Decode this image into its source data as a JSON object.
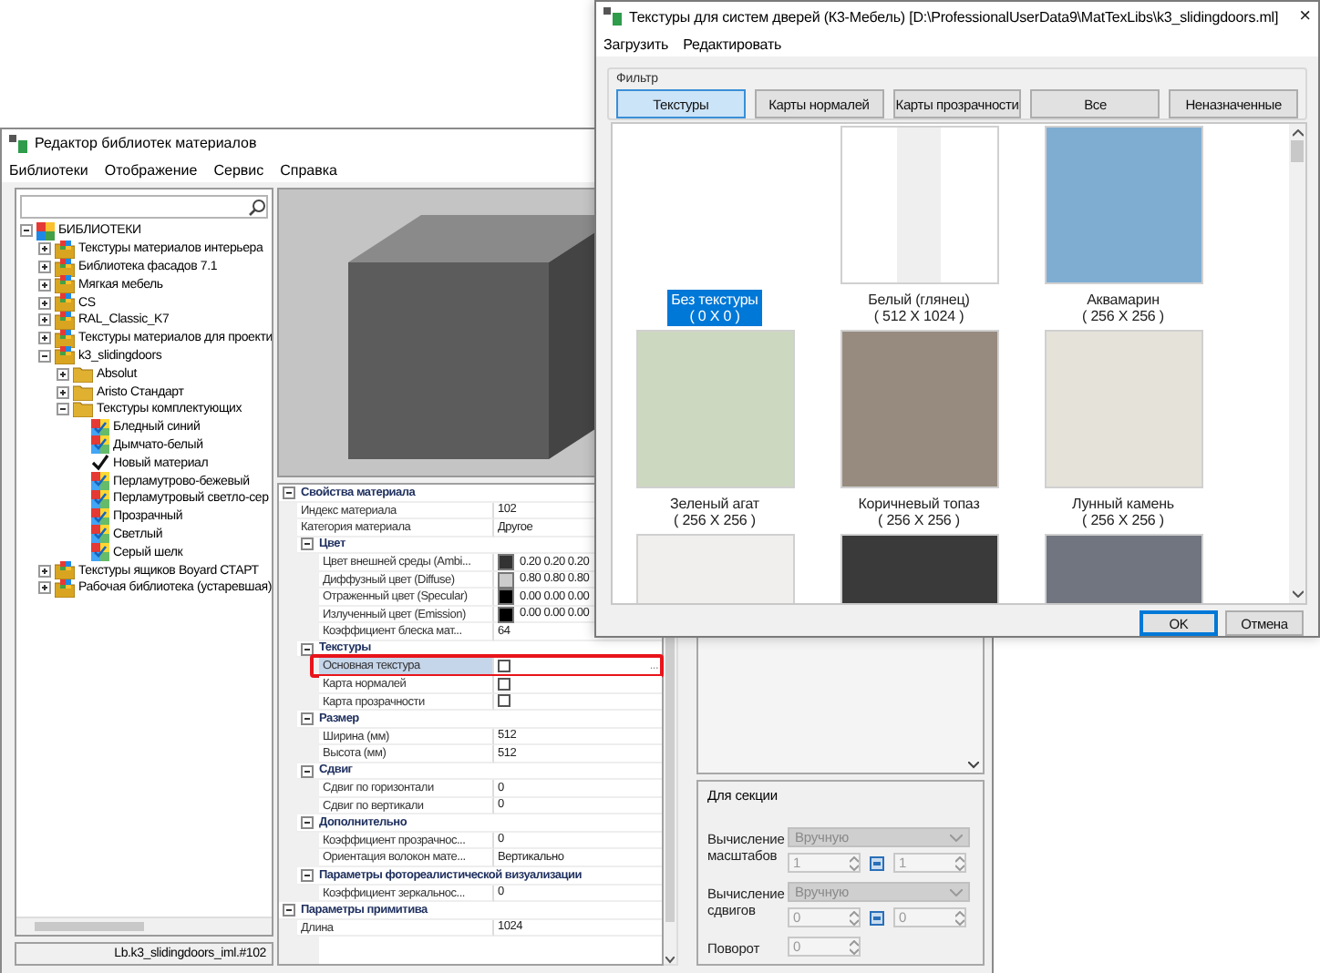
{
  "main_window": {
    "title": "Редактор библиотек материалов",
    "menu": [
      "Библиотеки",
      "Отображение",
      "Сервис",
      "Справка"
    ],
    "tree": [
      {
        "label": "БИБЛИОТЕКИ",
        "kind": "root",
        "expanded": true,
        "children": [
          {
            "label": "Текстуры материалов интерьера",
            "kind": "library",
            "expanded": false
          },
          {
            "label": "Библиотека фасадов 7.1",
            "kind": "library",
            "expanded": false
          },
          {
            "label": "Мягкая мебель",
            "kind": "library",
            "expanded": false
          },
          {
            "label": "CS",
            "kind": "library",
            "expanded": false
          },
          {
            "label": "RAL_Classic_K7",
            "kind": "library",
            "expanded": false
          },
          {
            "label": "Текстуры материалов для проекти",
            "kind": "library",
            "expanded": false
          },
          {
            "label": "k3_slidingdoors",
            "kind": "library",
            "expanded": true,
            "children": [
              {
                "label": "Absolut",
                "kind": "folder",
                "expanded": false
              },
              {
                "label": "Aristo Стандарт",
                "kind": "folder",
                "expanded": false
              },
              {
                "label": "Текстуры комплектующих",
                "kind": "folder",
                "expanded": true,
                "children": [
                  {
                    "label": "Бледный синий",
                    "kind": "material"
                  },
                  {
                    "label": "Дымчато-белый",
                    "kind": "material"
                  },
                  {
                    "label": "Новый материал",
                    "kind": "draft"
                  },
                  {
                    "label": "Перламутрово-бежевый",
                    "kind": "material"
                  },
                  {
                    "label": "Перламутровый светло-сер",
                    "kind": "material"
                  },
                  {
                    "label": "Прозрачный",
                    "kind": "material"
                  },
                  {
                    "label": "Светлый",
                    "kind": "material"
                  },
                  {
                    "label": "Серый шелк",
                    "kind": "material"
                  }
                ]
              }
            ]
          },
          {
            "label": "Текстуры ящиков Boyard СТАРТ",
            "kind": "library",
            "expanded": false
          },
          {
            "label": "Рабочая библиотека (устаревшая)",
            "kind": "library",
            "expanded": false
          }
        ]
      }
    ],
    "status": "Lb.k3_slidingdoors_iml.#102",
    "properties": [
      {
        "label": "Свойства материала",
        "expanded": true,
        "rows": [
          {
            "label": "Индекс материала",
            "value": "102",
            "kind": "text"
          },
          {
            "label": "Категория материала",
            "value": "Другое",
            "kind": "text"
          }
        ],
        "groups": [
          {
            "label": "Цвет",
            "expanded": true,
            "rows": [
              {
                "label": "Цвет внешней среды (Ambi...",
                "value": "0.20 0.20 0.20",
                "kind": "color",
                "color": "#333333"
              },
              {
                "label": "Диффузный цвет (Diffuse)",
                "value": "0.80 0.80 0.80",
                "kind": "color",
                "color": "#cccccc"
              },
              {
                "label": "Отраженный цвет (Specular)",
                "value": "0.00 0.00 0.00",
                "kind": "color",
                "color": "#000000"
              },
              {
                "label": "Излученный цвет (Emission)",
                "value": "0.00 0.00 0.00",
                "kind": "color",
                "color": "#000000"
              },
              {
                "label": "Коэффициент блеска мат...",
                "value": "64",
                "kind": "text"
              }
            ]
          },
          {
            "label": "Текстуры",
            "expanded": true,
            "rows": [
              {
                "label": "Основная текстура",
                "kind": "texture",
                "selected": true,
                "highlighted": true,
                "browse": "..."
              },
              {
                "label": "Карта нормалей",
                "kind": "texture",
                "selected": false,
                "highlighted": false
              },
              {
                "label": "Карта прозрачности",
                "kind": "texture",
                "selected": false,
                "highlighted": false
              }
            ]
          },
          {
            "label": "Размер",
            "expanded": true,
            "rows": [
              {
                "label": "Ширина (мм)",
                "value": "512",
                "kind": "text"
              },
              {
                "label": "Высота (мм)",
                "value": "512",
                "kind": "text"
              }
            ]
          },
          {
            "label": "Сдвиг",
            "expanded": true,
            "rows": [
              {
                "label": "Сдвиг по горизонтали",
                "value": "0",
                "kind": "text"
              },
              {
                "label": "Сдвиг по вертикали",
                "value": "0",
                "kind": "text"
              }
            ]
          },
          {
            "label": "Дополнительно",
            "expanded": true,
            "rows": [
              {
                "label": "Коэффициент прозрачнос...",
                "value": "0",
                "kind": "text"
              },
              {
                "label": "Ориентация волокон мате...",
                "value": "Вертикально",
                "kind": "text"
              }
            ]
          },
          {
            "label": "Параметры фотореалистической визуализации",
            "expanded": true,
            "rows": [
              {
                "label": "Коэффициент зеркальнос...",
                "value": "0",
                "kind": "text"
              }
            ]
          }
        ]
      },
      {
        "label": "Параметры примитива",
        "expanded": true,
        "rows": [
          {
            "label": "Длина",
            "value": "1024",
            "kind": "text"
          }
        ]
      }
    ],
    "section_panel": {
      "title": "Для секции",
      "fields": [
        {
          "label": "Вычисление масштабов",
          "mode": "Вручную",
          "values": [
            "1",
            "1"
          ],
          "linked": true,
          "disabled": true
        },
        {
          "label": "Вычисление сдвигов",
          "mode": "Вручную",
          "values": [
            "0",
            "0"
          ],
          "linked": true,
          "disabled": true
        },
        {
          "label": "Поворот",
          "values": [
            "0"
          ],
          "disabled": true
        }
      ]
    }
  },
  "dialog": {
    "title": "Текстуры для систем дверей (К3-Мебель) [D:\\ProfessionalUserData9\\MatTexLibs\\k3_slidingdoors.ml]",
    "close": "×",
    "menu": [
      "Загрузить",
      "Редактировать"
    ],
    "filter": {
      "title": "Фильтр",
      "buttons": [
        {
          "label": "Текстуры",
          "selected": true
        },
        {
          "label": "Карты нормалей",
          "selected": false
        },
        {
          "label": "Карты прозрачности",
          "selected": false
        },
        {
          "label": "Все",
          "selected": false
        },
        {
          "label": "Неназначенные",
          "selected": false
        }
      ]
    },
    "tiles": [
      {
        "name": "Без текстуры",
        "size": "( 0 X 0 )",
        "kind": "empty",
        "selected": true
      },
      {
        "name": "Белый (глянец)",
        "size": "( 512 X 1024 )",
        "kind": "gloss",
        "color": "#ffffff",
        "selected": false
      },
      {
        "name": "Аквамарин",
        "size": "( 256 X 256 )",
        "kind": "swatch",
        "color": "#7fadd2",
        "selected": false
      },
      {
        "name": "Зеленый агат",
        "size": "( 256 X 256 )",
        "kind": "swatch",
        "color": "#cdd8c0",
        "selected": false
      },
      {
        "name": "Коричневый топаз",
        "size": "( 256 X 256 )",
        "kind": "swatch",
        "color": "#978b7f",
        "selected": false
      },
      {
        "name": "Лунный камень",
        "size": "( 256 X 256 )",
        "kind": "swatch",
        "color": "#e5e2d9",
        "selected": false
      },
      {
        "kind": "swatch",
        "color": "#f0efed",
        "selected": false
      },
      {
        "kind": "swatch",
        "color": "#3a3a3a",
        "selected": false
      },
      {
        "kind": "swatch",
        "color": "#70757f",
        "selected": false
      }
    ],
    "buttons": [
      {
        "label": "OK",
        "default": true
      },
      {
        "label": "Отмена",
        "default": false
      }
    ]
  }
}
